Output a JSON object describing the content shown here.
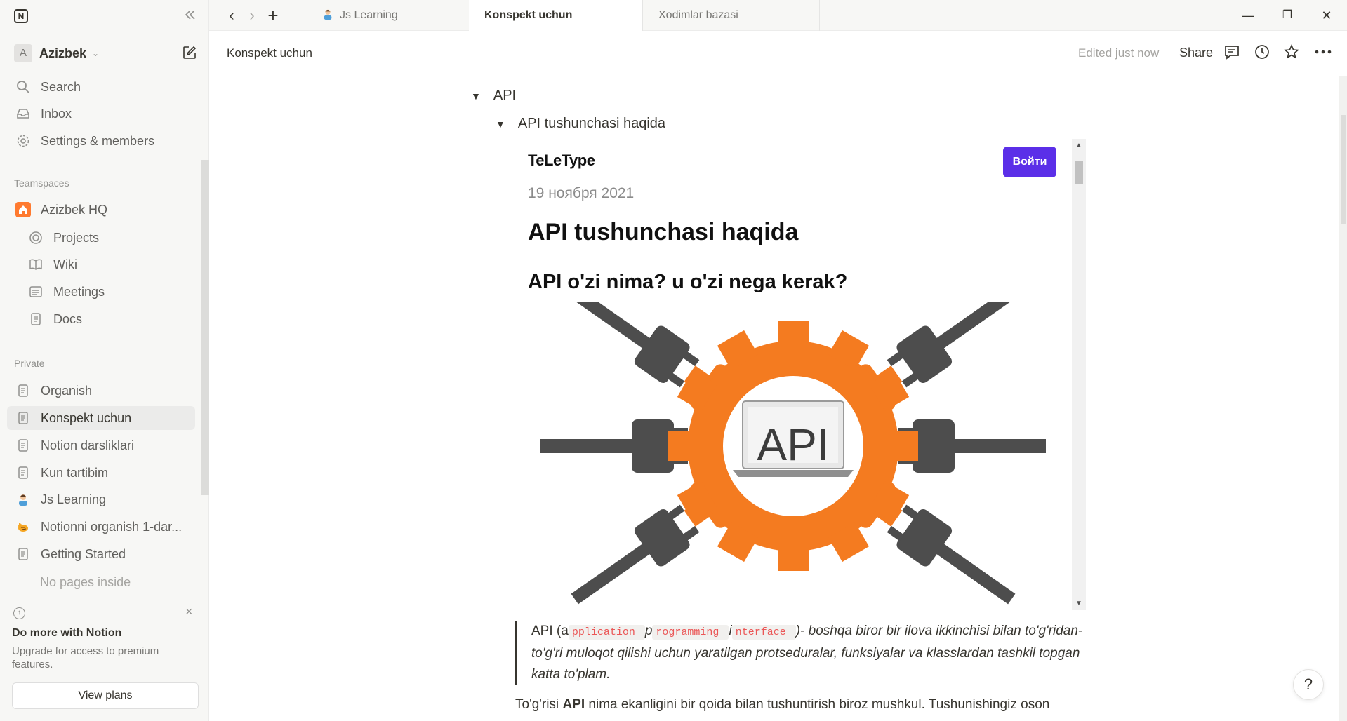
{
  "app": {
    "logo": "N"
  },
  "tabs": {
    "items": [
      {
        "label": "Js Learning",
        "icon": "person-emoji-icon"
      },
      {
        "label": "Konspekt uchun",
        "active": true
      },
      {
        "label": "Xodimlar bazasi"
      }
    ]
  },
  "sidebar": {
    "workspace": {
      "initial": "A",
      "name": "Azizbek"
    },
    "nav": [
      {
        "label": "Search",
        "icon": "search-icon"
      },
      {
        "label": "Inbox",
        "icon": "inbox-icon"
      },
      {
        "label": "Settings & members",
        "icon": "gear-icon"
      }
    ],
    "teamspaces_title": "Teamspaces",
    "teamspace": {
      "label": "Azizbek HQ",
      "icon": "home-icon",
      "color": "#ff7a2f"
    },
    "teamspace_pages": [
      {
        "label": "Projects",
        "icon": "target-icon"
      },
      {
        "label": "Wiki",
        "icon": "book-icon"
      },
      {
        "label": "Meetings",
        "icon": "calendar-list-icon"
      },
      {
        "label": "Docs",
        "icon": "page-icon"
      }
    ],
    "private_title": "Private",
    "private_pages": [
      {
        "label": "Organish",
        "icon": "page-icon"
      },
      {
        "label": "Konspekt uchun",
        "icon": "page-icon",
        "active": true
      },
      {
        "label": "Notion darsliklari",
        "icon": "page-icon"
      },
      {
        "label": "Kun tartibim",
        "icon": "page-icon"
      },
      {
        "label": "Js Learning",
        "icon": "person-emoji-icon"
      },
      {
        "label": "Notionni organish 1-dar...",
        "icon": "cat-emoji-icon"
      },
      {
        "label": "Getting Started",
        "icon": "page-icon"
      }
    ],
    "no_pages": "No pages inside",
    "upsell": {
      "title": "Do more with Notion",
      "desc": "Upgrade for access to premium features.",
      "button": "View plans"
    }
  },
  "topbar": {
    "breadcrumb": "Konspekt uchun",
    "edited": "Edited just now",
    "share": "Share"
  },
  "content": {
    "toggle_1": "API",
    "toggle_2": "API tushunchasi haqida",
    "embed": {
      "logo": "TeLeType",
      "login": "Войти",
      "date": "19 ноября 2021",
      "h1": "API tushunchasi haqida",
      "h2": "API o'zi nima? u o'zi nega kerak?",
      "graphic_text": "API",
      "colors": {
        "gear": "#f47b20",
        "plug": "#4d4d4d",
        "button": "#5b2fe8"
      }
    },
    "quote": {
      "lead": "API (a",
      "code_1": "pplication ",
      "mid_1": "p",
      "code_2": "rogramming ",
      "mid_2": "i",
      "code_3": "nterface ",
      "rest": ")- boshqa biror bir ilova ikkinchisi bilan to'g'ridan-to'g'ri muloqot qilishi uchun yaratilgan protseduralar, funksiyalar va klasslardan tashkil topgan katta to'plam."
    },
    "paragraph": {
      "before": "To'g'risi ",
      "bold": "API",
      "after": " nima ekanligini bir qoida bilan tushuntirish biroz mushkul. Tushunishingiz oson"
    },
    "help": "?"
  }
}
